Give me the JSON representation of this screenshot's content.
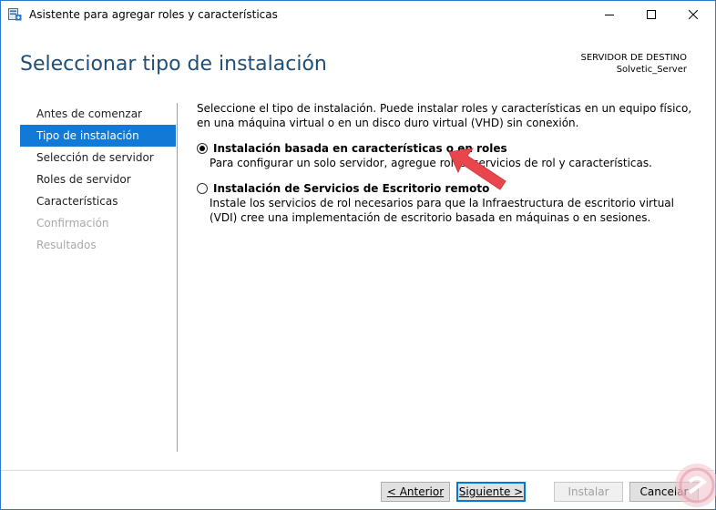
{
  "window": {
    "title": "Asistente para agregar roles y características"
  },
  "header": {
    "title": "Seleccionar tipo de instalación",
    "destination_label": "SERVIDOR DE DESTINO",
    "destination_server": "Solvetic_Server"
  },
  "nav": {
    "items": [
      {
        "label": "Antes de comenzar",
        "state": "normal"
      },
      {
        "label": "Tipo de instalación",
        "state": "active"
      },
      {
        "label": "Selección de servidor",
        "state": "normal"
      },
      {
        "label": "Roles de servidor",
        "state": "normal"
      },
      {
        "label": "Características",
        "state": "normal"
      },
      {
        "label": "Confirmación",
        "state": "disabled"
      },
      {
        "label": "Resultados",
        "state": "disabled"
      }
    ]
  },
  "content": {
    "intro": "Seleccione el tipo de instalación. Puede instalar roles y características en un equipo físico, en una máquina virtual o en un disco duro virtual (VHD) sin conexión.",
    "options": [
      {
        "title": "Instalación basada en características o en roles",
        "description": "Para configurar un solo servidor, agregue roles, servicios de rol y características.",
        "selected": true
      },
      {
        "title": "Instalación de Servicios de Escritorio remoto",
        "description": "Instale los servicios de rol necesarios para que la Infraestructura de escritorio virtual (VDI) cree una implementación de escritorio basada en máquinas o en sesiones.",
        "selected": false
      }
    ]
  },
  "buttons": {
    "previous": "< Anterior",
    "next": "Siguiente >",
    "install": "Instalar",
    "cancel": "Cancelar"
  },
  "colors": {
    "accent": "#1279d6",
    "title": "#1f4e79",
    "annotation_arrow": "#e8464c"
  }
}
